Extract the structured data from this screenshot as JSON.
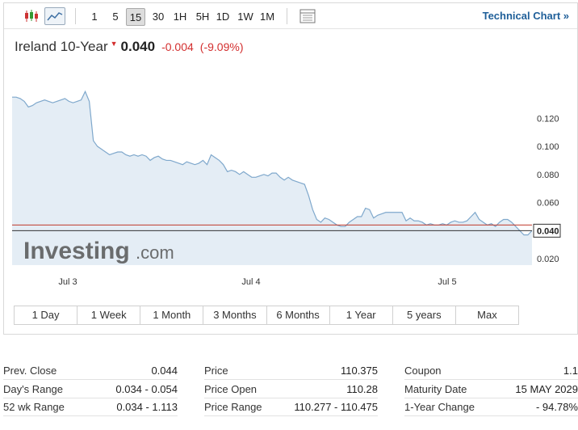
{
  "toolbar": {
    "periods": [
      "1",
      "5",
      "15",
      "30",
      "1H",
      "5H",
      "1D",
      "1W",
      "1M"
    ],
    "selected_period": "15",
    "technical_link": "Technical Chart »"
  },
  "header": {
    "name": "Ireland 10-Year",
    "price": "0.040",
    "change": "-0.004",
    "change_pct": "(-9.09%)"
  },
  "chart_data": {
    "type": "area",
    "x_ticks": [
      "Jul 3",
      "Jul 4",
      "Jul 5"
    ],
    "y_ticks": [
      0.02,
      0.04,
      0.06,
      0.08,
      0.1,
      0.12
    ],
    "ylim": [
      0.0155,
      0.1535
    ],
    "current_value": 0.04,
    "current_label": "0.040",
    "prev_close": 0.044,
    "series": [
      {
        "values": [
          0.135,
          0.135,
          0.134,
          0.132,
          0.128,
          0.129,
          0.131,
          0.132,
          0.133,
          0.132,
          0.131,
          0.132,
          0.133,
          0.134,
          0.132,
          0.131,
          0.132,
          0.133,
          0.139,
          0.132,
          0.104,
          0.1,
          0.098,
          0.096,
          0.094,
          0.095,
          0.096,
          0.096,
          0.094,
          0.093,
          0.094,
          0.093,
          0.094,
          0.093,
          0.09,
          0.092,
          0.093,
          0.091,
          0.09,
          0.09,
          0.089,
          0.088,
          0.087,
          0.089,
          0.088,
          0.087,
          0.088,
          0.09,
          0.087,
          0.094,
          0.092,
          0.09,
          0.087,
          0.082,
          0.083,
          0.082,
          0.08,
          0.082,
          0.08,
          0.078,
          0.078,
          0.079,
          0.08,
          0.079,
          0.081,
          0.081,
          0.078,
          0.076,
          0.078,
          0.076,
          0.075,
          0.074,
          0.073,
          0.065,
          0.055,
          0.048,
          0.046,
          0.049,
          0.048,
          0.046,
          0.044,
          0.043,
          0.043,
          0.046,
          0.048,
          0.05,
          0.05,
          0.056,
          0.055,
          0.049,
          0.051,
          0.052,
          0.053,
          0.053,
          0.053,
          0.053,
          0.053,
          0.047,
          0.049,
          0.047,
          0.047,
          0.046,
          0.044,
          0.045,
          0.044,
          0.044,
          0.045,
          0.044,
          0.046,
          0.047,
          0.046,
          0.046,
          0.047,
          0.05,
          0.053,
          0.048,
          0.046,
          0.044,
          0.045,
          0.043,
          0.046,
          0.048,
          0.048,
          0.046,
          0.043,
          0.04,
          0.037,
          0.037,
          0.04
        ]
      }
    ]
  },
  "watermark": {
    "brand": "Investing",
    "suffix": ".com"
  },
  "ranges": [
    "1 Day",
    "1 Week",
    "1 Month",
    "3 Months",
    "6 Months",
    "1 Year",
    "5 years",
    "Max"
  ],
  "stats": {
    "col1": [
      {
        "label": "Prev. Close",
        "value": "0.044"
      },
      {
        "label": "Day's Range",
        "value": "0.034 - 0.054"
      },
      {
        "label": "52 wk Range",
        "value": "0.034 - 1.113"
      }
    ],
    "col2": [
      {
        "label": "Price",
        "value": "110.375"
      },
      {
        "label": "Price Open",
        "value": "110.28"
      },
      {
        "label": "Price Range",
        "value": "110.277 - 110.475"
      }
    ],
    "col3": [
      {
        "label": "Coupon",
        "value": "1.1"
      },
      {
        "label": "Maturity Date",
        "value": "15 MAY 2029"
      },
      {
        "label": "1-Year Change",
        "value": "- 94.78%"
      }
    ]
  },
  "colors": {
    "line": "#7fa8cc",
    "area": "#e4edf5",
    "down": "#d32f2f",
    "prev_close_line": "#c0392b",
    "link": "#1f5f99"
  }
}
